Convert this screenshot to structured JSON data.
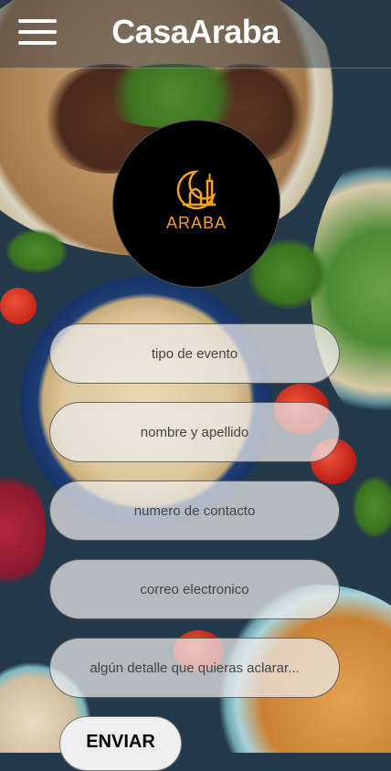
{
  "header": {
    "title": "CasaAraba",
    "menu_icon": "hamburger-menu-icon"
  },
  "logo": {
    "text": "ARABA",
    "icon": "mosque-crescent-icon",
    "accent_color": "#f3a21f"
  },
  "form": {
    "event_type_placeholder": "tipo de evento",
    "name_placeholder": "nombre y apellido",
    "phone_placeholder": "numero de contacto",
    "email_placeholder": "correo electronico",
    "details_placeholder": "algún detalle que quieras aclarar...",
    "submit_label": "ENVIAR"
  }
}
